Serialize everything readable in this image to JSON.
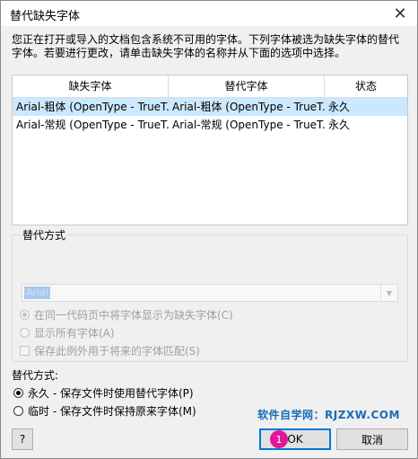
{
  "window": {
    "title": "替代缺失字体",
    "close_glyph": "✕"
  },
  "description": "您正在打开或导入的文档包含系统不可用的字体。下列字体被选为缺失字体的替代字体。若要进行更改，请单击缺失字体的名称并从下面的选项中选择。",
  "table": {
    "headers": [
      "缺失字体",
      "替代字体",
      "状态"
    ],
    "rows": [
      {
        "missing": "Arial-粗体 (OpenType - TrueT...",
        "substitute": "Arial-粗体 (OpenType - TrueT...",
        "status": "永久",
        "selected": true
      },
      {
        "missing": "Arial-常规 (OpenType - TrueT...",
        "substitute": "Arial-常规 (OpenType - TrueT...",
        "status": "永久",
        "selected": false
      }
    ]
  },
  "substitution_group": {
    "legend": "替代方式",
    "font_value": "Arial",
    "options": [
      {
        "label": "在同一代码页中将字体显示为缺失字体(C)",
        "checked": true
      },
      {
        "label": "显示所有字体(A)",
        "checked": false
      }
    ],
    "checkbox_label": "保存此例外用于将来的字体匹配(S)"
  },
  "mode": {
    "label": "替代方式:",
    "options": [
      {
        "label": "永久 - 保存文件时使用替代字体(P)",
        "checked": true
      },
      {
        "label": "临时 - 保存文件时保持原来字体(M)",
        "checked": false
      }
    ]
  },
  "watermark": "软件自学网：RJZXW.COM",
  "buttons": {
    "help": "?",
    "ok": "OK",
    "cancel": "取消",
    "ok_badge": "1"
  },
  "colors": {
    "selection": "#cce8ff",
    "accent": "#0078d7",
    "badge": "#e0189a",
    "watermark": "#1a6bb8"
  }
}
